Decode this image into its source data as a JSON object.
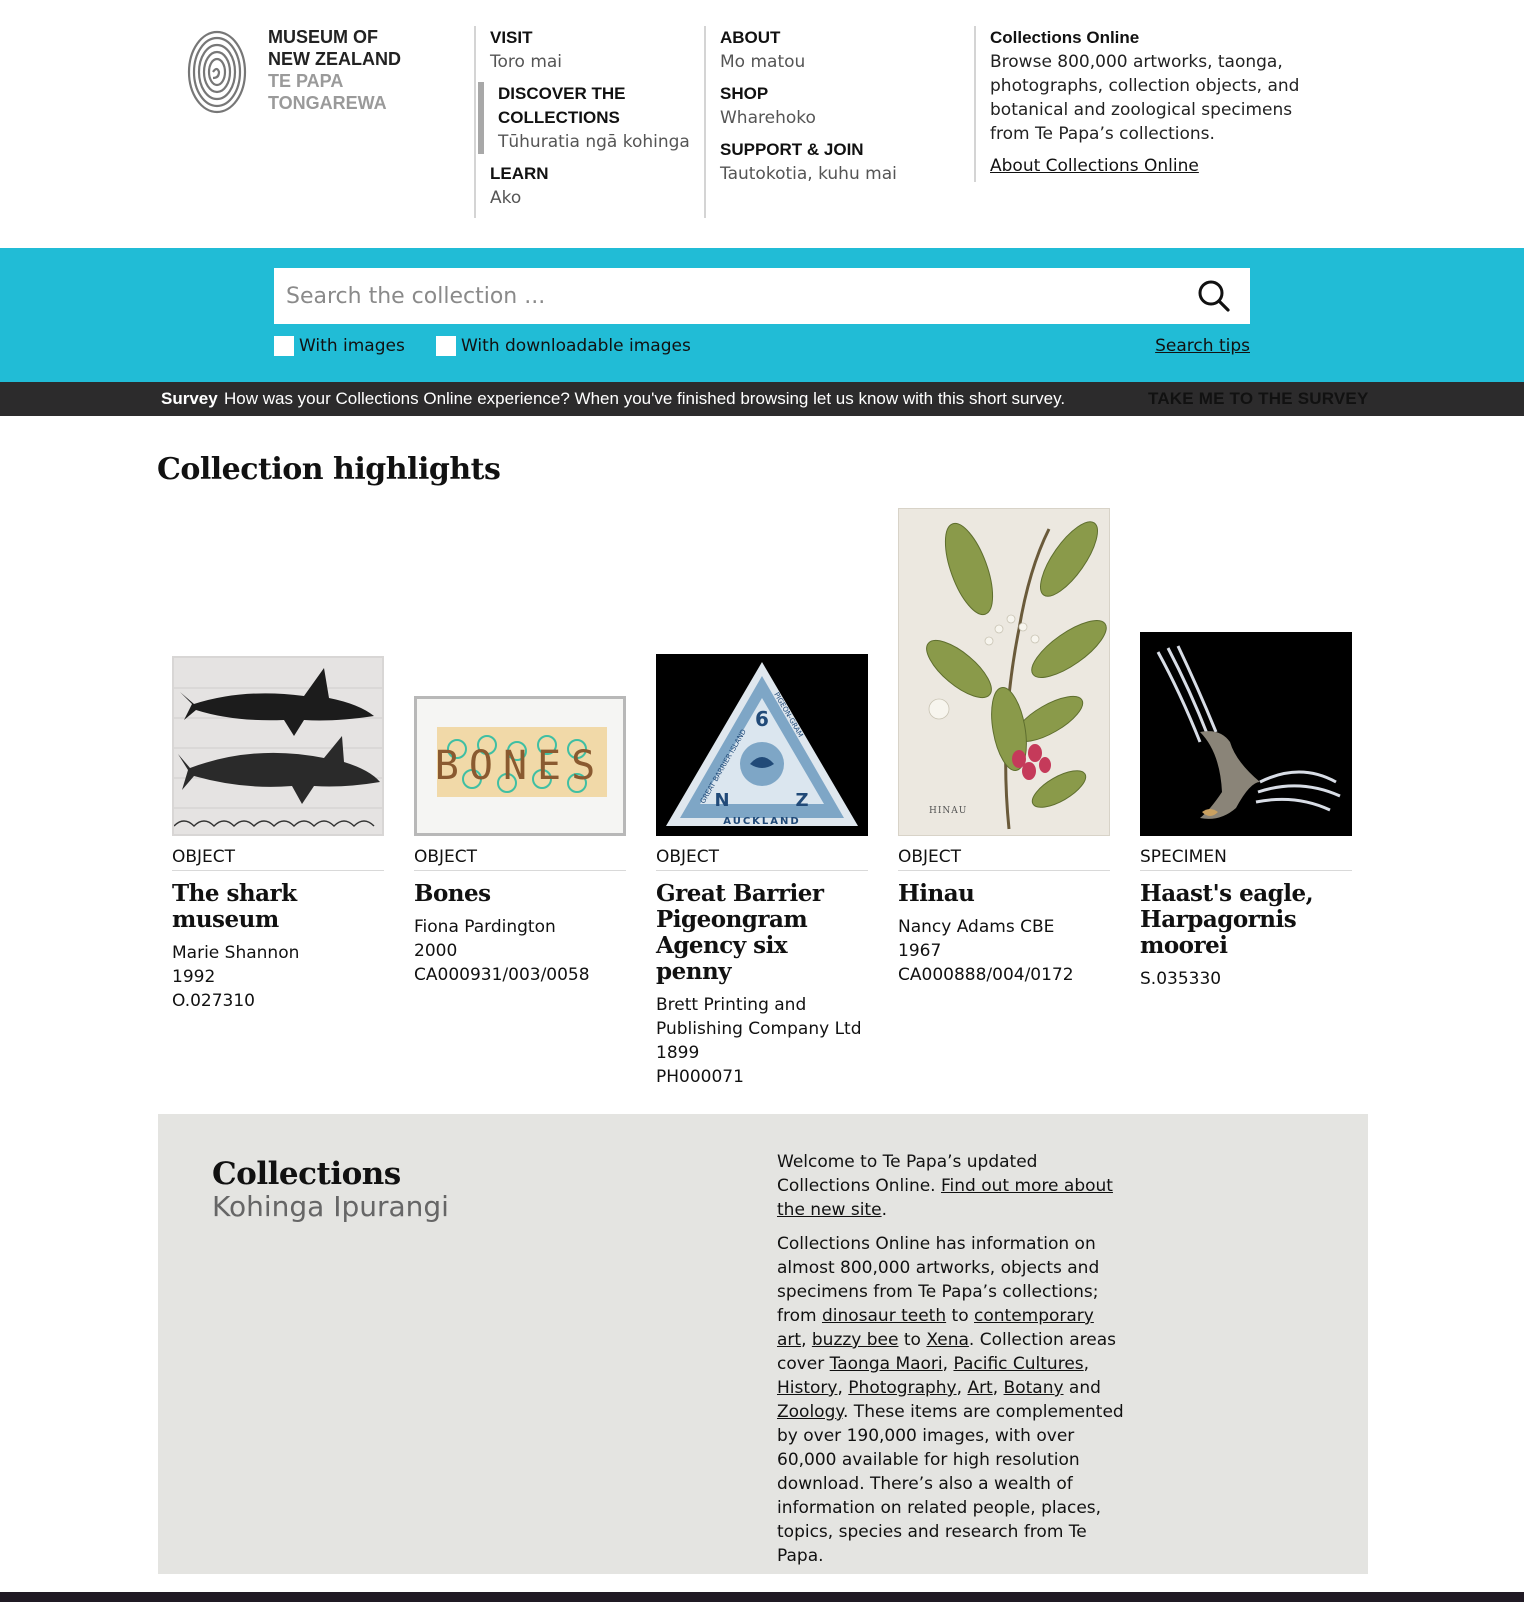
{
  "logo": {
    "line1": "MUSEUM OF",
    "line2": "NEW ZEALAND",
    "line3": "TE PAPA",
    "line4": "TONGAREWA"
  },
  "nav": {
    "visit": {
      "en": "VISIT",
      "mi": "Toro mai"
    },
    "discover": {
      "en": "DISCOVER THE COLLECTIONS",
      "mi": "Tūhuratia ngā kohinga"
    },
    "learn": {
      "en": "LEARN",
      "mi": "Ako"
    },
    "about": {
      "en": "ABOUT",
      "mi": "Mo matou"
    },
    "shop": {
      "en": "SHOP",
      "mi": "Wharehoko"
    },
    "support": {
      "en": "SUPPORT & JOIN",
      "mi": "Tautokotia, kuhu mai"
    }
  },
  "collections_online": {
    "title": "Collections Online",
    "description": "Browse 800,000 artworks, taonga, photographs, collection objects, and botanical and zoological specimens from Te Papa’s collections.",
    "link": "About Collections Online"
  },
  "search": {
    "placeholder": "Search the collection ...",
    "value": "",
    "icon": "search-icon",
    "with_images": "With images",
    "with_downloadable": "With downloadable images",
    "tips": "Search tips"
  },
  "survey": {
    "lead": "Survey",
    "message": "How was your Collections Online experience? When you've finished browsing let us know with this short survey.",
    "cta": "TAKE ME TO THE SURVEY"
  },
  "highlights": {
    "heading": "Collection highlights",
    "items": [
      {
        "type": "OBJECT",
        "title": "The shark museum",
        "lines": [
          "Marie Shannon",
          "1992",
          "O.027310"
        ]
      },
      {
        "type": "OBJECT",
        "title": "Bones",
        "lines": [
          "Fiona Pardington",
          "2000",
          "CA000931/003/0058"
        ]
      },
      {
        "type": "OBJECT",
        "title": "Great Barrier Pigeongram Agency six penny",
        "lines": [
          "Brett Printing and Publishing Company Ltd",
          "1899",
          "PH000071"
        ]
      },
      {
        "type": "OBJECT",
        "title": "Hinau",
        "lines": [
          "Nancy Adams CBE",
          "1967",
          "CA000888/004/0172"
        ]
      },
      {
        "type": "SPECIMEN",
        "title": "Haast's eagle, Harpagornis moorei",
        "lines": [
          "S.035330"
        ]
      }
    ]
  },
  "stamp": {
    "value": "6",
    "left": "N",
    "right": "Z",
    "bottom": "AUCKLAND",
    "side_left": "GREAT BARRIER ISLAND",
    "side_right": "PIGEON-GRAM"
  },
  "bones_art": {
    "text": "BONES"
  },
  "hinau_label": "HINAU",
  "collections": {
    "heading": "Collections",
    "subheading": "Kohinga Ipurangi",
    "p1_text": "Welcome to Te Papa’s updated Collections Online. ",
    "p1_link": "Find out more about the new site",
    "p2_a": "Collections Online has information on almost 800,000 artworks, objects and specimens from Te Papa’s collections; from ",
    "link_dino": "dinosaur teeth",
    "to1": " to ",
    "link_contemporary": "contemporary art",
    "comma1": ",",
    "link_buzzy": "buzzy bee",
    "to2": " to ",
    "link_xena": "Xena",
    "p2_b": ". Collection areas cover ",
    "link_taonga": "Taonga Maori",
    "link_pacific": "Pacific Cultures",
    "link_history": "History",
    "link_photography": "Photography",
    "link_art": "Art",
    "link_botany": "Botany",
    "and": " and ",
    "link_zoology": "Zoology",
    "p2_c": ". These items are complemented by over 190,000 images, with over 60,000 available for high resolution download. There’s also a wealth of information on related people, places, topics, species and research from Te Papa."
  },
  "colors": {
    "accent": "#21bcd6",
    "survey_bg": "#2c2b2c",
    "panel_bg": "#e4e4e1"
  }
}
